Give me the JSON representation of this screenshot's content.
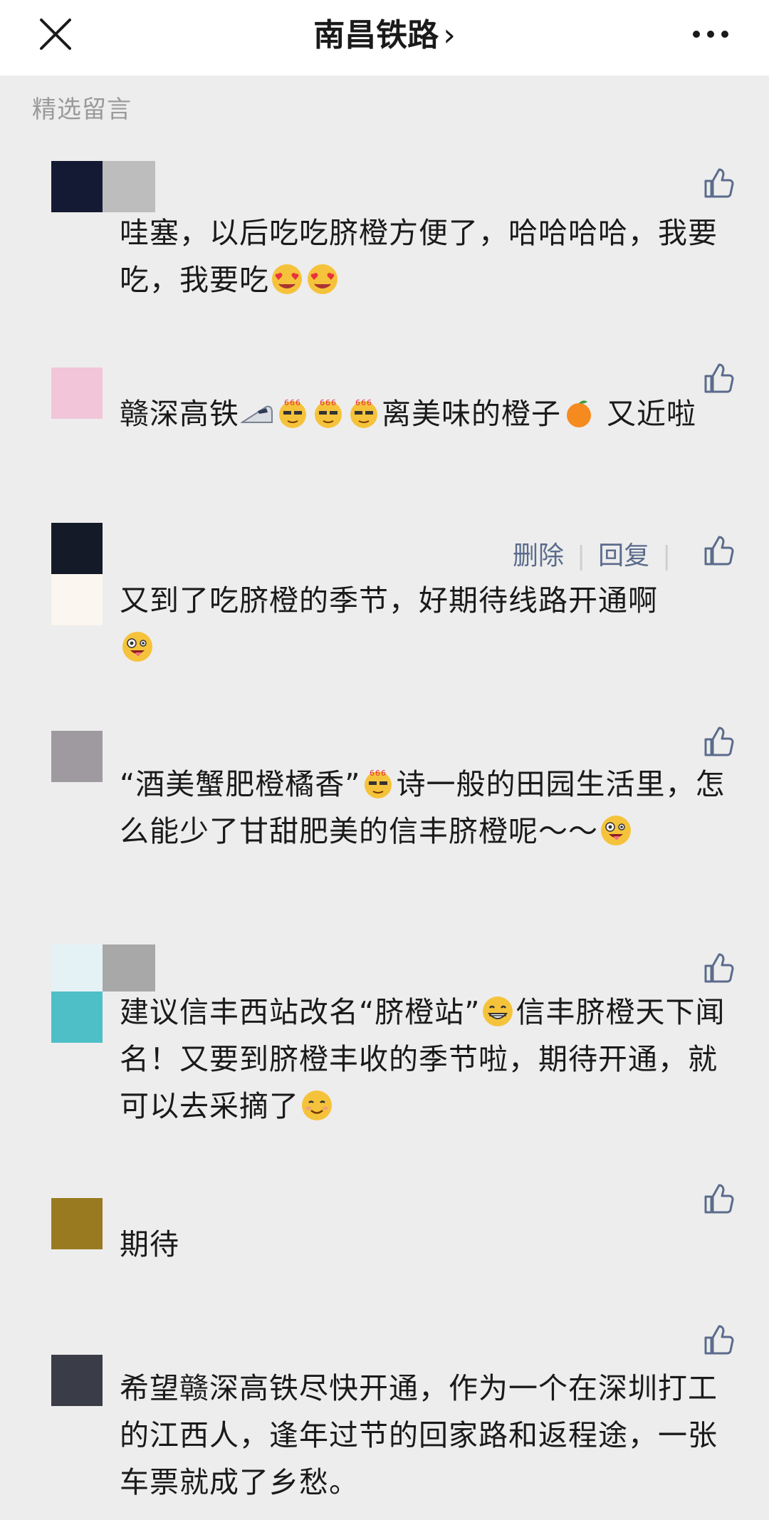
{
  "header": {
    "title": "南昌铁路",
    "chevron": "›",
    "close_icon": "close-icon",
    "more_icon": "more-dots-icon"
  },
  "section_label": "精选留言",
  "colors": {
    "link": "#5b6b8c",
    "background": "#ededed",
    "text": "#1a1a1a"
  },
  "comments": [
    {
      "text": "哇塞，以后吃吃脐橙方便了，哈哈哈哈，我要吃，我要吃",
      "emojis": [
        "heart-eyes-emoji",
        "heart-eyes-emoji"
      ]
    },
    {
      "text_parts": [
        "赣深高铁",
        "离美味的橙子",
        "又近啦"
      ],
      "emojis": [
        "bullet-train-emoji",
        "666-emoji",
        "666-emoji",
        "666-emoji",
        "tangerine-emoji"
      ]
    },
    {
      "text": "又到了吃脐橙的季节，好期待线路开通啊",
      "actions": {
        "delete": "删除",
        "reply": "回复"
      },
      "emojis": [
        "crazy-face-emoji"
      ]
    },
    {
      "text_parts": [
        "“酒美蟹肥橙橘香”",
        "诗一般的田园生活里，怎么能少了甘甜肥美的信丰脐橙呢～～"
      ],
      "emojis": [
        "666-emoji",
        "crazy-face-emoji"
      ]
    },
    {
      "text_parts": [
        "建议信丰西站改名“脐橙站”",
        "信丰脐橙天下闻名！又要到脐橙丰收的季节啦，期待开通，就可以去采摘了"
      ],
      "emojis": [
        "grin-emoji",
        "smile-emoji"
      ]
    },
    {
      "text": "期待"
    },
    {
      "text": "希望赣深高铁尽快开通，作为一个在深圳打工的江西人，逢年过节的回家路和返程途，一张车票就成了乡愁。"
    }
  ]
}
